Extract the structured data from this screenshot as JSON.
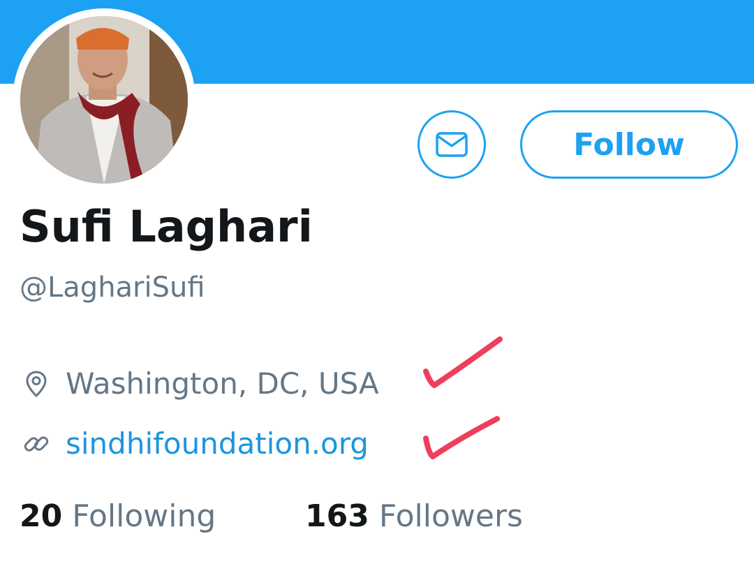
{
  "profile": {
    "display_name": "Sufi Laghari",
    "handle": "@LaghariSufi",
    "location": "Washington, DC, USA",
    "website": "sindhifoundation.org"
  },
  "actions": {
    "message_icon": "envelope-icon",
    "follow_label": "Follow"
  },
  "stats": {
    "following_count": "20",
    "following_label": "Following",
    "followers_count": "163",
    "followers_label": "Followers"
  },
  "icons": {
    "location": "location-pin-icon",
    "website": "link-icon"
  },
  "colors": {
    "banner": "#1da1f2",
    "accent": "#1da1f2",
    "link": "#1b95e0",
    "secondary_text": "#657786",
    "primary_text": "#14171a",
    "annotation": "#ef3e5c"
  }
}
